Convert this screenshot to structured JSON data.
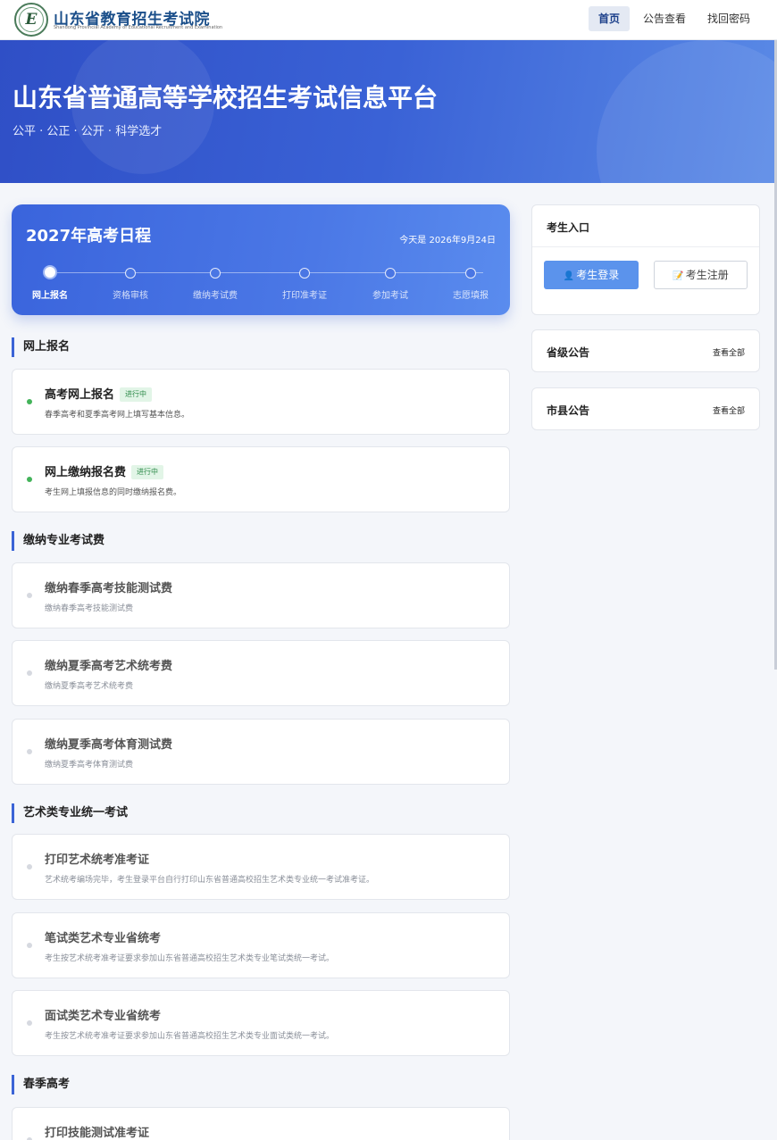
{
  "header": {
    "org_name": "山东省教育招生考试院",
    "org_name_en": "Shandong Provincial Academy of Educational Recruitment and Examination",
    "nav": {
      "home": "首页",
      "notice": "公告查看",
      "password": "找回密码"
    }
  },
  "banner": {
    "title": "山东省普通高等学校招生考试信息平台",
    "subtitle": "公平 · 公正 · 公开 · 科学选才"
  },
  "schedule": {
    "title": "2027年高考日程",
    "today": "今天是 2026年9月24日",
    "steps": [
      "网上报名",
      "资格审核",
      "缴纳考试费",
      "打印准考证",
      "参加考试",
      "志愿填报"
    ],
    "active_step": 0
  },
  "sections": {
    "s1": {
      "title": "网上报名",
      "items": [
        {
          "title": "高考网上报名",
          "badge": "进行中",
          "desc": "春季高考和夏季高考网上填写基本信息。"
        },
        {
          "title": "网上缴纳报名费",
          "badge": "进行中",
          "desc": "考生网上填报信息的同时缴纳报名费。"
        }
      ]
    },
    "s2": {
      "title": "缴纳专业考试费",
      "items": [
        {
          "title": "缴纳春季高考技能测试费",
          "desc": "缴纳春季高考技能测试费"
        },
        {
          "title": "缴纳夏季高考艺术统考费",
          "desc": "缴纳夏季高考艺术统考费"
        },
        {
          "title": "缴纳夏季高考体育测试费",
          "desc": "缴纳夏季高考体育测试费"
        }
      ]
    },
    "s3": {
      "title": "艺术类专业统一考试",
      "items": [
        {
          "title": "打印艺术统考准考证",
          "desc": "艺术统考编场完毕，考生登录平台自行打印山东省普通高校招生艺术类专业统一考试准考证。"
        },
        {
          "title": "笔试类艺术专业省统考",
          "desc": "考生按艺术统考准考证要求参加山东省普通高校招生艺术类专业笔试类统一考试。"
        },
        {
          "title": "面试类艺术专业省统考",
          "desc": "考生按艺术统考准考证要求参加山东省普通高校招生艺术类专业面试类统一考试。"
        }
      ]
    },
    "s4": {
      "title": "春季高考",
      "items": [
        {
          "title": "打印技能测试准考证"
        }
      ]
    }
  },
  "sidebar": {
    "entry": {
      "title": "考生入口",
      "login": "考生登录",
      "register": "考生注册"
    },
    "provincial": {
      "title": "省级公告",
      "more": "查看全部"
    },
    "city": {
      "title": "市县公告",
      "more": "查看全部"
    }
  },
  "colors": {
    "primary": "#3b64d6",
    "active_green": "#43b35a",
    "login_button": "#5b93ec"
  }
}
